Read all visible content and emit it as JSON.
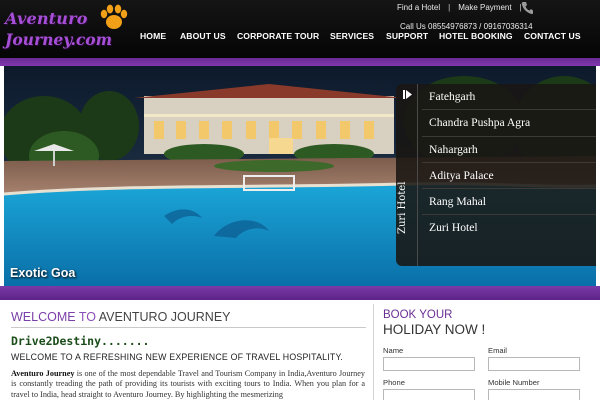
{
  "brand": {
    "logo_line1": "Aventuro",
    "logo_line2": "Journey.com"
  },
  "top_links": {
    "find_hotel": "Find a Hotel",
    "make_payment": "Make Payment",
    "separator": "|"
  },
  "contact": {
    "phones": "Call Us 08554976873  /  09167036314",
    "phone_icon": "phone-icon"
  },
  "nav": [
    {
      "label": "HOME"
    },
    {
      "label": "ABOUT US"
    },
    {
      "label": "CORPORATE TOUR"
    },
    {
      "label": "SERVICES"
    },
    {
      "label": "SUPPORT"
    },
    {
      "label": "HOTEL BOOKING"
    },
    {
      "label": "CONTACT US"
    }
  ],
  "hero": {
    "caption": "Exotic Goa",
    "panel_title": "Zuri Hotel",
    "hotels": [
      {
        "name": "Fatehgarh"
      },
      {
        "name": "Chandra Pushpa Agra"
      },
      {
        "name": "Nahargarh"
      },
      {
        "name": "Aditya Palace"
      },
      {
        "name": "Rang Mahal"
      },
      {
        "name": "Zuri Hotel"
      }
    ]
  },
  "welcome": {
    "heading_prefix": "WELCOME ",
    "heading_to": "TO ",
    "heading_brand": "AVENTURO JOURNEY",
    "tagline": "Drive2Destiny.......",
    "subhead": "WELCOME TO A REFRESHING NEW EXPERIENCE OF TRAVEL HOSPITALITY.",
    "para_bold": "Aventuro Journey",
    "para_text": " is one of the most dependable Travel and Tourism Company in India,Aventuro Journey is constantly treading the path of providing its tourists with exciting tours to India. When you plan for a travel to India, head straight to Aventuro Journey. By highlighting the mesmerizing"
  },
  "booking": {
    "title_line1": "BOOK YOUR",
    "title_line2": "HOLIDAY NOW !",
    "fields": {
      "name": "Name",
      "email": "Email",
      "phone": "Phone",
      "mobile": "Mobile Number"
    }
  },
  "colors": {
    "accent_purple": "#7a3aa8",
    "header_black": "#0b0b0b",
    "tagline_green": "#1a4d1a"
  }
}
